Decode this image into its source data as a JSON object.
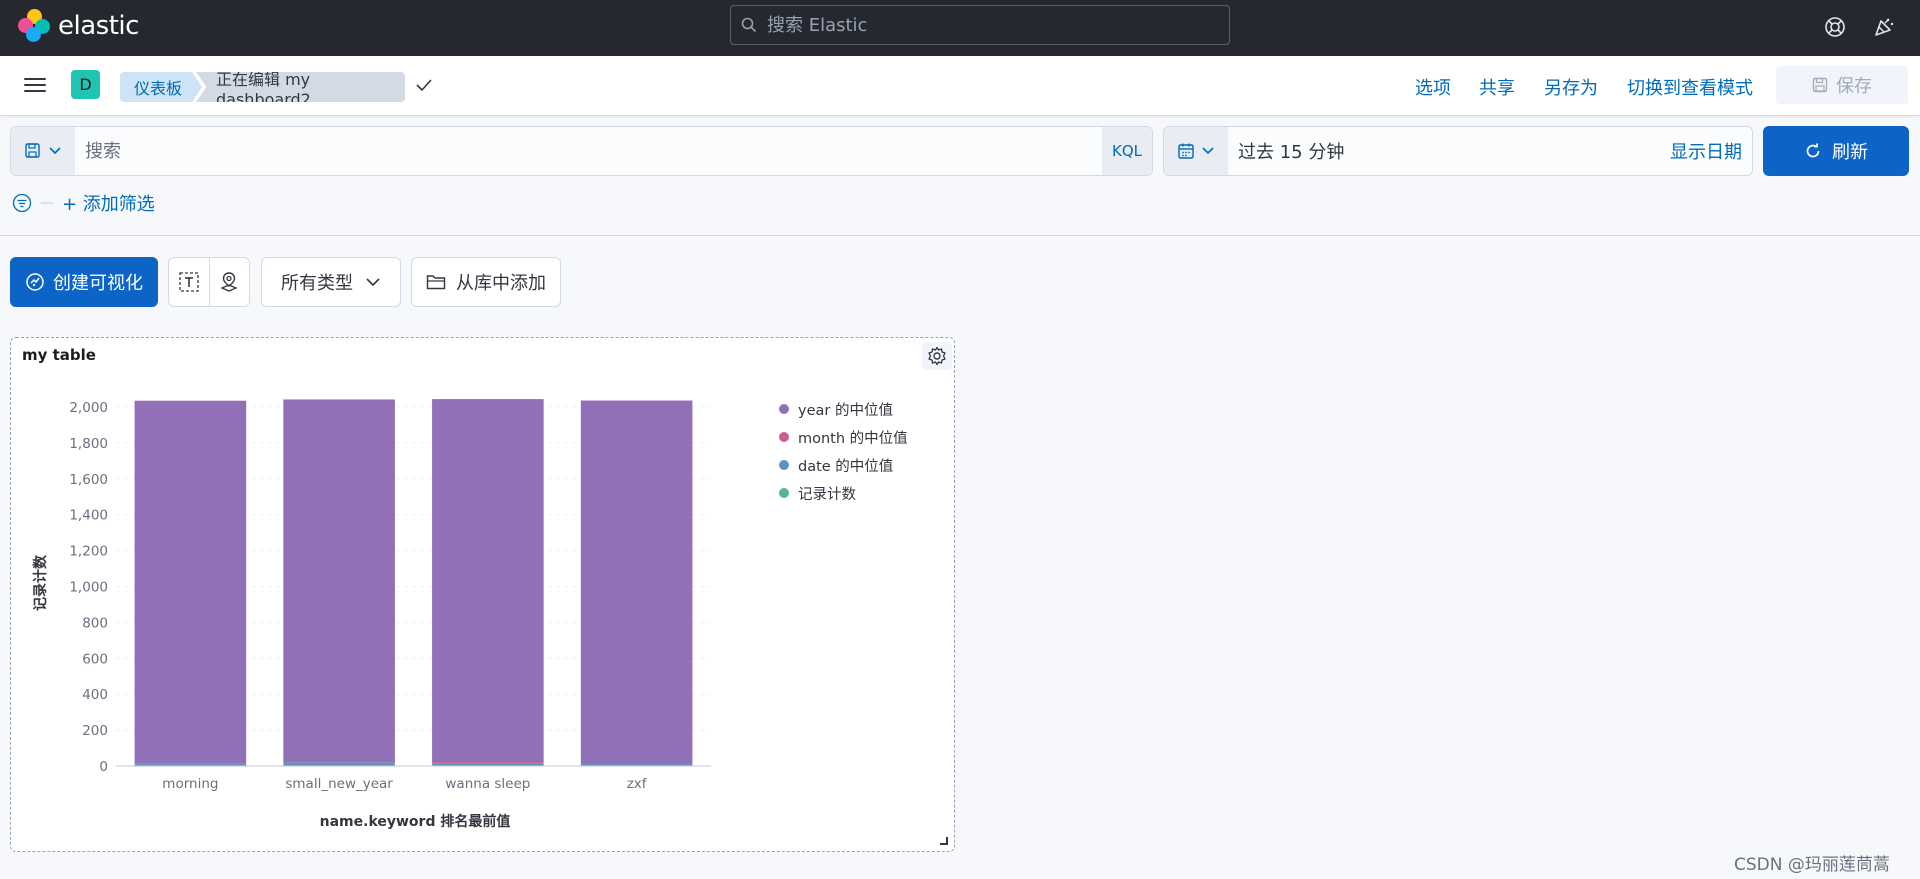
{
  "header": {
    "logo_text": "elastic",
    "search_placeholder": "搜索 Elastic"
  },
  "navbar": {
    "space_initial": "D",
    "breadcrumbs": [
      "仪表板",
      "正在编辑 my dashboard2"
    ],
    "actions": [
      "选项",
      "共享",
      "另存为",
      "切换到查看模式"
    ],
    "save_label": "保存"
  },
  "query": {
    "placeholder": "搜索",
    "language": "KQL",
    "time_range": "过去 15 分钟",
    "show_dates": "显示日期",
    "refresh_label": "刷新",
    "add_filter": "+ 添加筛选"
  },
  "toolbar": {
    "create_label": "创建可视化",
    "types_label": "所有类型",
    "library_label": "从库中添加"
  },
  "panel": {
    "title": "my table",
    "legend": [
      {
        "name": "year 的中位值",
        "color": "#9170b8"
      },
      {
        "name": "month 的中位值",
        "color": "#ca5f91"
      },
      {
        "name": "date 的中位值",
        "color": "#6092c0"
      },
      {
        "name": "记录计数",
        "color": "#54b399"
      }
    ]
  },
  "chart_data": {
    "type": "bar",
    "stacked": true,
    "categories": [
      "morning",
      "small_new_year",
      "wanna sleep",
      "zxf"
    ],
    "series": [
      {
        "name": "记录计数",
        "values": [
          1,
          1,
          1,
          1
        ],
        "color": "#54b399"
      },
      {
        "name": "date 的中位值",
        "values": [
          10,
          18,
          15,
          10
        ],
        "color": "#6092c0"
      },
      {
        "name": "month 的中位值",
        "values": [
          2,
          1,
          6,
          3
        ],
        "color": "#ca5f91"
      },
      {
        "name": "year 的中位值",
        "values": [
          2022,
          2022,
          2022,
          2022
        ],
        "color": "#9170b8"
      }
    ],
    "xlabel": "name.keyword 排名最前值",
    "ylabel": "记录计数",
    "ylim": [
      0,
      2000
    ],
    "yticks": [
      "0",
      "200",
      "400",
      "600",
      "800",
      "1,000",
      "1,200",
      "1,400",
      "1,600",
      "1,800",
      "2,000"
    ],
    "ytick_values": [
      0,
      200,
      400,
      600,
      800,
      1000,
      1200,
      1400,
      1600,
      1800,
      2000
    ],
    "grid": true,
    "legend_position": "right"
  },
  "watermark": "CSDN @玛丽莲茼蒿"
}
